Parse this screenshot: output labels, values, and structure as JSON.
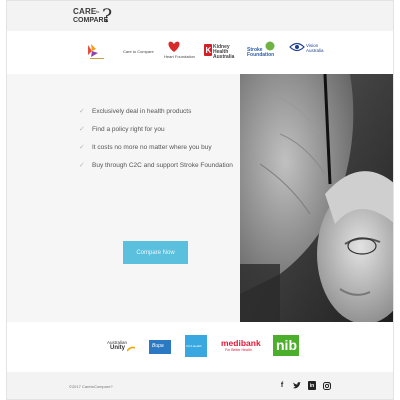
{
  "brand": {
    "line1": "CARE",
    "line2": "to",
    "line3": "COMPARE",
    "mark": "?"
  },
  "partners": [
    {
      "name": "partner-1",
      "label": ""
    },
    {
      "name": "partner-2",
      "label": "Care to Compare"
    },
    {
      "name": "heart-foundation",
      "label": "Heart Foundation"
    },
    {
      "name": "kidney-health",
      "label": "Kidney Health Australia"
    },
    {
      "name": "stroke-foundation",
      "label": "Stroke Foundation"
    },
    {
      "name": "vision-australia",
      "label": "Vision Australia"
    }
  ],
  "hero": {
    "benefits": [
      "Exclusively deal in health products",
      "Find a policy right for you",
      "It costs no more no matter where you buy",
      "Buy through C2C and support Stroke Foundation"
    ],
    "cta_label": "Compare Now",
    "tick_icon": "check-icon"
  },
  "insurers": [
    {
      "label1": "Australian",
      "label2": "Unity"
    },
    {
      "label1": "Bupa"
    },
    {
      "label1": "CUA Health"
    },
    {
      "label1": "medibank",
      "label2": "For Better Health"
    },
    {
      "label1": "nib"
    }
  ],
  "footer": {
    "copyright": "©2017 CaretoCompare?",
    "social": [
      "f",
      "t",
      "in",
      "ig"
    ]
  },
  "colors": {
    "accent": "#5bc0de",
    "header_bg": "#f3f3f3",
    "hero_bg": "#f6f6f6",
    "medibank_red": "#e31837",
    "nib_green": "#4caf2b",
    "heart_red": "#d92a2a",
    "kidney_red": "#d32027",
    "stroke_green": "#6fb443",
    "vision_blue": "#1f3f8f"
  }
}
